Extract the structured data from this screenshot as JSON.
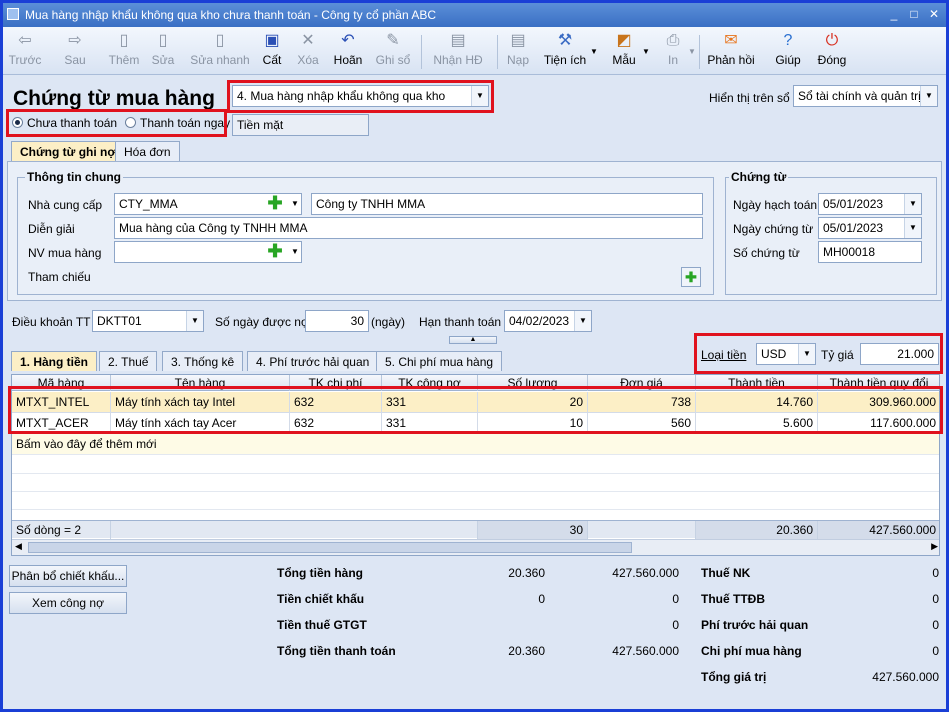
{
  "window": {
    "title": "Mua hàng nhập khẩu không qua kho chưa thanh toán - Công ty cổ phần ABC",
    "minimize": "_",
    "maximize": "□",
    "close": "✕"
  },
  "toolbar": {
    "back": "Trước",
    "forward": "Sau",
    "add": "Thêm",
    "edit": "Sửa",
    "quick_edit": "Sửa nhanh",
    "save": "Cất",
    "delete": "Xóa",
    "undo": "Hoãn",
    "post": "Ghi sổ",
    "receive_invoice": "Nhận HĐ",
    "load": "Nạp",
    "utilities": "Tiện ích",
    "template": "Mẫu",
    "print": "In",
    "feedback": "Phản hồi",
    "help": "Giúp",
    "close": "Đóng"
  },
  "header": {
    "title": "Chứng từ mua hàng",
    "purchase_type": "4. Mua hàng nhập khẩu không qua kho",
    "display_label": "Hiển thị trên sổ",
    "display_value": "Sổ tài chính và quản trị",
    "radio_unpaid": "Chưa thanh toán",
    "radio_paid": "Thanh toán ngay",
    "payment_method": "Tiền mặt"
  },
  "tabs": {
    "debt_voucher": "Chứng từ ghi nợ",
    "invoice": "Hóa đơn"
  },
  "general": {
    "section_title": "Thông tin chung",
    "supplier_label": "Nhà cung cấp",
    "supplier_code": "CTY_MMA",
    "supplier_name": "Công ty TNHH MMA",
    "description_label": "Diễn giải",
    "description": "Mua hàng của Công ty TNHH MMA",
    "buyer_label": "NV mua hàng",
    "buyer": "",
    "reference_label": "Tham chiếu"
  },
  "voucher": {
    "section_title": "Chứng từ",
    "posting_date_label": "Ngày hạch toán",
    "posting_date": "05/01/2023",
    "voucher_date_label": "Ngày chứng từ",
    "voucher_date": "05/01/2023",
    "voucher_no_label": "Số chứng từ",
    "voucher_no": "MH00018"
  },
  "terms": {
    "terms_label": "Điều khoản TT",
    "terms_value": "DKTT01",
    "days_label": "Số ngày được nợ",
    "days_value": "30",
    "days_unit": "(ngày)",
    "due_label": "Hạn thanh toán",
    "due_value": "04/02/2023"
  },
  "currency": {
    "type_label": "Loại tiền",
    "type_value": "USD",
    "rate_label": "Tỷ giá",
    "rate_value": "21.000"
  },
  "detail_tabs": {
    "t1": "1. Hàng tiền",
    "t2": "2. Thuế",
    "t3": "3. Thống kê",
    "t4": "4. Phí trước hải quan",
    "t5": "5. Chi phí mua hàng"
  },
  "grid": {
    "columns": [
      "Mã hàng",
      "Tên hàng",
      "TK chi phí",
      "TK công nợ",
      "Số lượng",
      "Đơn giá",
      "Thành tiền",
      "Thành tiền quy đổi"
    ],
    "rows": [
      {
        "code": "MTXT_INTEL",
        "name": "Máy tính xách tay Intel",
        "exp_acc": "632",
        "pay_acc": "331",
        "qty": "20",
        "price": "738",
        "amount": "14.760",
        "amount_vnd": "309.960.000"
      },
      {
        "code": "MTXT_ACER",
        "name": "Máy tính xách tay Acer",
        "exp_acc": "632",
        "pay_acc": "331",
        "qty": "10",
        "price": "560",
        "amount": "5.600",
        "amount_vnd": "117.600.000"
      }
    ],
    "add_hint": "Bấm vào đây để thêm mới",
    "footer": {
      "row_count": "Số dòng = 2",
      "qty_total": "30",
      "amount_total": "20.360",
      "amount_vnd_total": "427.560.000"
    }
  },
  "buttons": {
    "allocate_discount": "Phân bổ chiết khấu...",
    "view_debt": "Xem công nợ"
  },
  "totals": {
    "goods_label": "Tổng tiền hàng",
    "goods_fc": "20.360",
    "goods_vnd": "427.560.000",
    "discount_label": "Tiền chiết khấu",
    "discount_fc": "0",
    "discount_vnd": "0",
    "vat_label": "Tiền thuế GTGT",
    "vat_vnd": "0",
    "payment_label": "Tổng tiền thanh toán",
    "payment_fc": "20.360",
    "payment_vnd": "427.560.000",
    "import_tax_label": "Thuế NK",
    "import_tax": "0",
    "excise_label": "Thuế TTĐB",
    "excise": "0",
    "customs_fee_label": "Phí trước hải quan",
    "customs_fee": "0",
    "purchase_cost_label": "Chi phí mua hàng",
    "purchase_cost": "0",
    "total_value_label": "Tổng giá trị",
    "total_value": "427.560.000"
  }
}
